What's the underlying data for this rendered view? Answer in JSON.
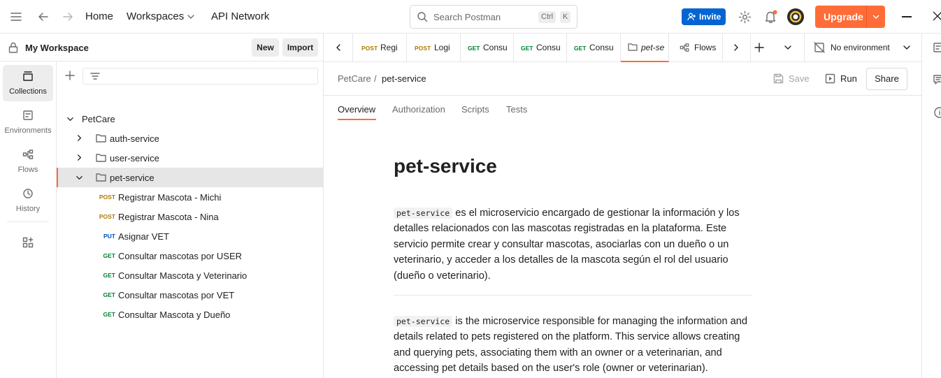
{
  "topbar": {
    "home": "Home",
    "workspaces": "Workspaces",
    "api_network": "API Network",
    "search_placeholder": "Search Postman",
    "shortcut_ctrl": "Ctrl",
    "shortcut_k": "K",
    "invite": "Invite",
    "upgrade": "Upgrade"
  },
  "workspace": {
    "title": "My Workspace",
    "new_label": "New",
    "import_label": "Import"
  },
  "rail": {
    "items": [
      {
        "label": "Collections",
        "icon": "collections-icon",
        "active": true
      },
      {
        "label": "Environments",
        "icon": "environments-icon"
      },
      {
        "label": "Flows",
        "icon": "flows-icon"
      },
      {
        "label": "History",
        "icon": "history-icon"
      }
    ]
  },
  "tree": {
    "collection": "PetCare",
    "folders": [
      "auth-service",
      "user-service",
      "pet-service"
    ],
    "requests": [
      {
        "method": "POST",
        "name": "Registrar Mascota - Michi"
      },
      {
        "method": "POST",
        "name": "Registrar Mascota - Nina"
      },
      {
        "method": "PUT",
        "name": "Asignar VET"
      },
      {
        "method": "GET",
        "name": "Consultar mascotas por USER"
      },
      {
        "method": "GET",
        "name": "Consultar Mascota y Veterinario"
      },
      {
        "method": "GET",
        "name": "Consultar mascotas por VET"
      },
      {
        "method": "GET",
        "name": "Consultar Mascota y Dueño"
      }
    ]
  },
  "tabs": [
    {
      "method": "POST",
      "title": "Regi"
    },
    {
      "method": "POST",
      "title": "Logi"
    },
    {
      "method": "GET",
      "title": "Consu"
    },
    {
      "method": "GET",
      "title": "Consu"
    },
    {
      "method": "GET",
      "title": "Consu"
    },
    {
      "method": "",
      "title": "pet-se",
      "active": true
    },
    {
      "method": "",
      "title": "Flows"
    }
  ],
  "environment": "No environment",
  "breadcrumb": {
    "parent": "PetCare",
    "separator": "/",
    "current": "pet-service"
  },
  "actions": {
    "save": "Save",
    "run": "Run",
    "share": "Share"
  },
  "subtabs": [
    "Overview",
    "Authorization",
    "Scripts",
    "Tests"
  ],
  "doc": {
    "title": "pet-service",
    "code_term": "pet-service",
    "para_es": " es el microservicio encargado de gestionar la información y los detalles relacionados con las mascotas registradas en la plataforma. Este servicio permite crear y consultar mascotas, asociarlas con un dueño o un veterinario, y acceder a los detalles de la mascota según el rol del usuario (dueño o veterinario).",
    "para_en": " is the microservice responsible for managing the information and details related to pets registered on the platform. This service allows creating and querying pets, associating them with an owner or a veterinarian, and accessing pet details based on the user's role (owner or veterinarian)."
  },
  "colors": {
    "accent": "#ff6c37",
    "invite_blue": "#0265d2",
    "post": "#ad7a03",
    "get": "#007f31",
    "put": "#0053b8"
  }
}
